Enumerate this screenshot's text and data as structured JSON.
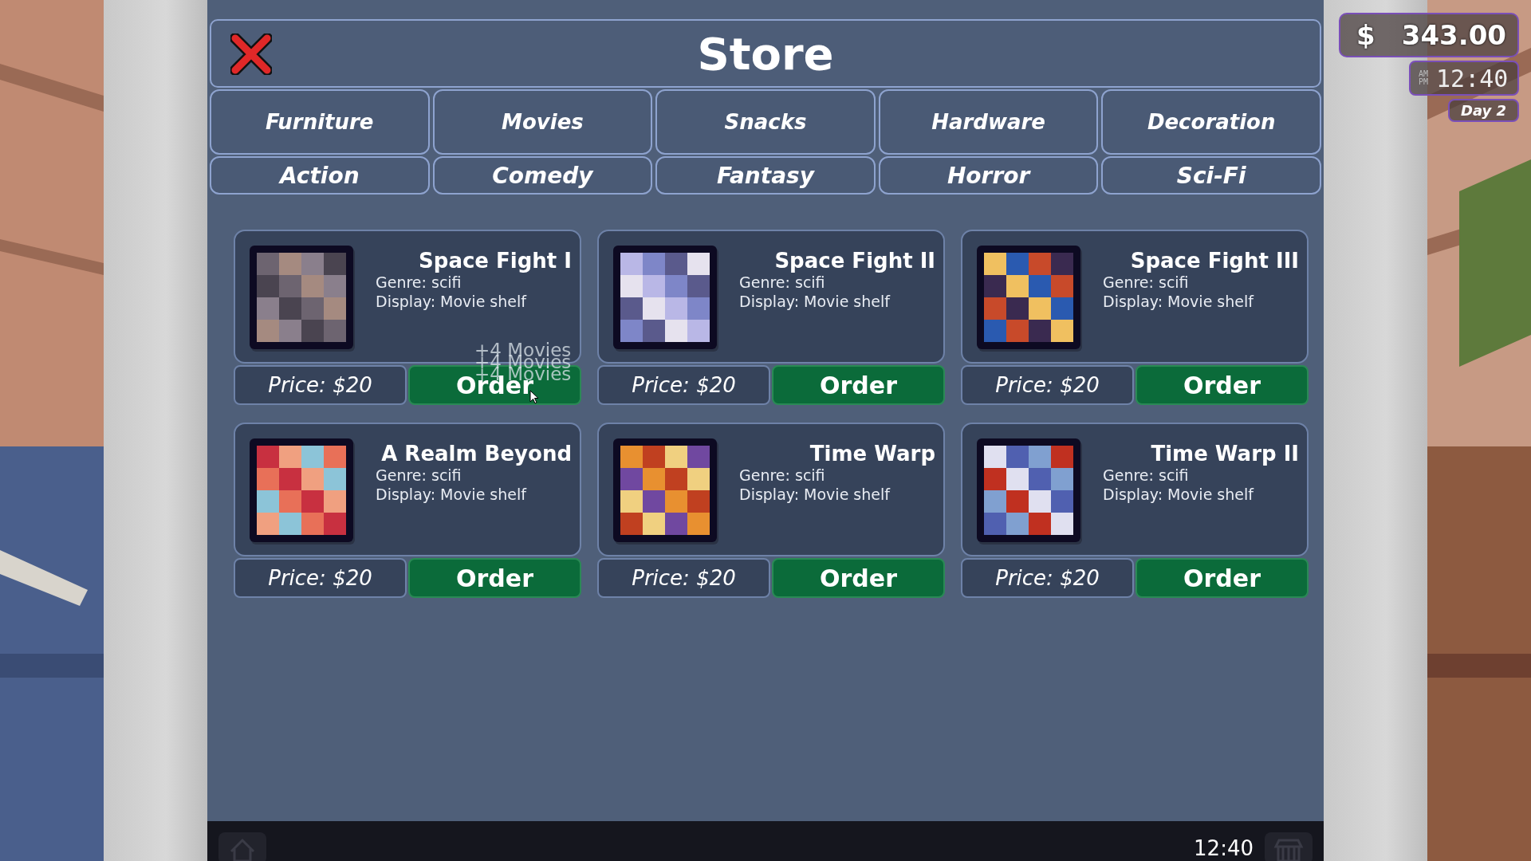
{
  "store": {
    "title": "Store",
    "categories": [
      "Furniture",
      "Movies",
      "Snacks",
      "Hardware",
      "Decoration"
    ],
    "genres": [
      "Action",
      "Comedy",
      "Fantasy",
      "Horror",
      "Sci-Fi"
    ],
    "items": [
      {
        "title": "Space Fight I",
        "genre": "Genre: scifi",
        "display": "Display: Movie shelf",
        "price": "Price: $20",
        "button": "Order"
      },
      {
        "title": "Space Fight II",
        "genre": "Genre: scifi",
        "display": "Display: Movie shelf",
        "price": "Price: $20",
        "button": "Order"
      },
      {
        "title": "Space Fight III",
        "genre": "Genre: scifi",
        "display": "Display: Movie shelf",
        "price": "Price: $20",
        "button": "Order"
      },
      {
        "title": "A Realm Beyond",
        "genre": "Genre: scifi",
        "display": "Display: Movie shelf",
        "price": "Price: $20",
        "button": "Order"
      },
      {
        "title": "Time Warp",
        "genre": "Genre: scifi",
        "display": "Display: Movie shelf",
        "price": "Price: $20",
        "button": "Order"
      },
      {
        "title": "Time Warp II",
        "genre": "Genre: scifi",
        "display": "Display: Movie shelf",
        "price": "Price: $20",
        "button": "Order"
      }
    ],
    "notifications": [
      "+4 Movies",
      "+4 Movies",
      "+4 Movies"
    ]
  },
  "hud": {
    "currency": "$",
    "money": "343.00",
    "am": "AM",
    "pm": "PM",
    "clock": "12:40",
    "day": "Day 2"
  },
  "taskbar": {
    "time": "12:40"
  }
}
